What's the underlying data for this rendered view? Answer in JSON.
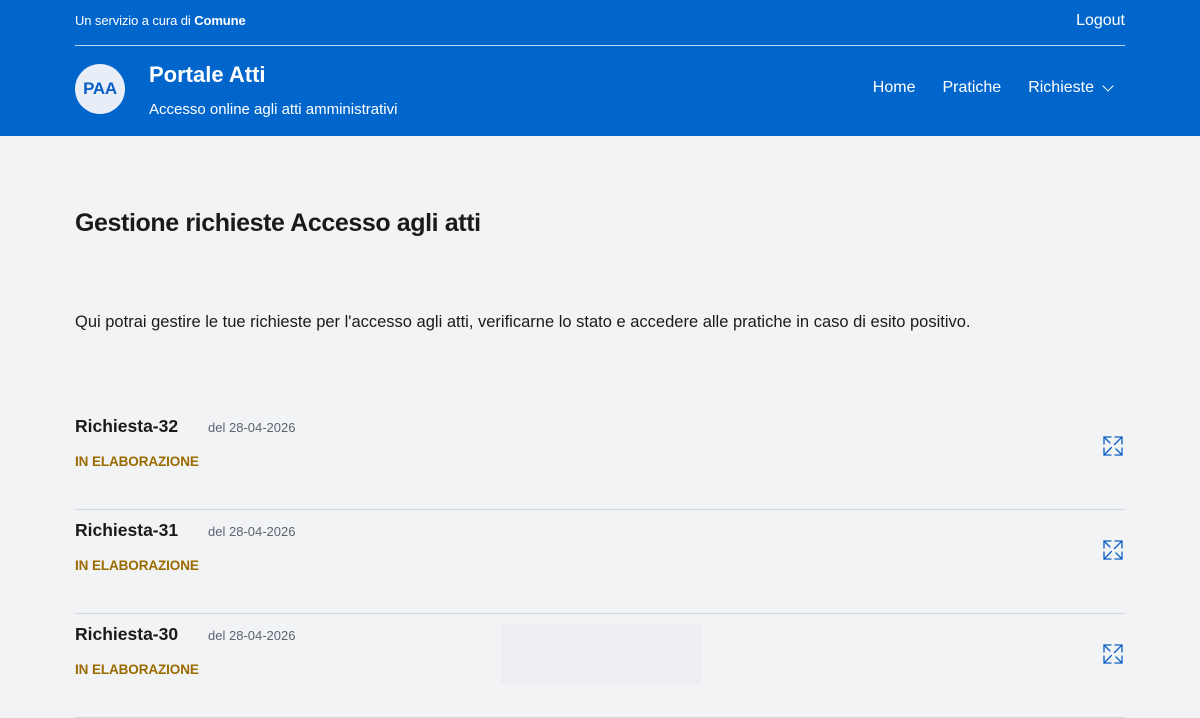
{
  "header": {
    "service_prefix": "Un servizio a cura di",
    "service_owner": "Comune",
    "logout_label": "Logout",
    "logo_text": "PAA",
    "title": "Portale Atti",
    "subtitle": "Accesso online agli atti amministrativi",
    "nav": [
      {
        "label": "Home"
      },
      {
        "label": "Pratiche"
      },
      {
        "label": "Richieste"
      }
    ]
  },
  "page": {
    "title": "Gestione richieste Accesso agli atti",
    "description": "Qui potrai gestire le tue richieste per l'accesso agli atti, verificarne lo stato e accedere alle pratiche in caso di esito positivo."
  },
  "requests": [
    {
      "name": "Richiesta-32",
      "date": "del 28-04-2026",
      "status": "IN ELABORAZIONE"
    },
    {
      "name": "Richiesta-31",
      "date": "del 28-04-2026",
      "status": "IN ELABORAZIONE"
    },
    {
      "name": "Richiesta-30",
      "date": "del 28-04-2026",
      "status": "IN ELABORAZIONE"
    }
  ],
  "colors": {
    "brand": "#0066cc",
    "status_pending": "#9a6b00",
    "background": "#f2f3f5"
  },
  "icons": {
    "expand": "expand-icon",
    "dropdown": "chevron-down-icon"
  }
}
